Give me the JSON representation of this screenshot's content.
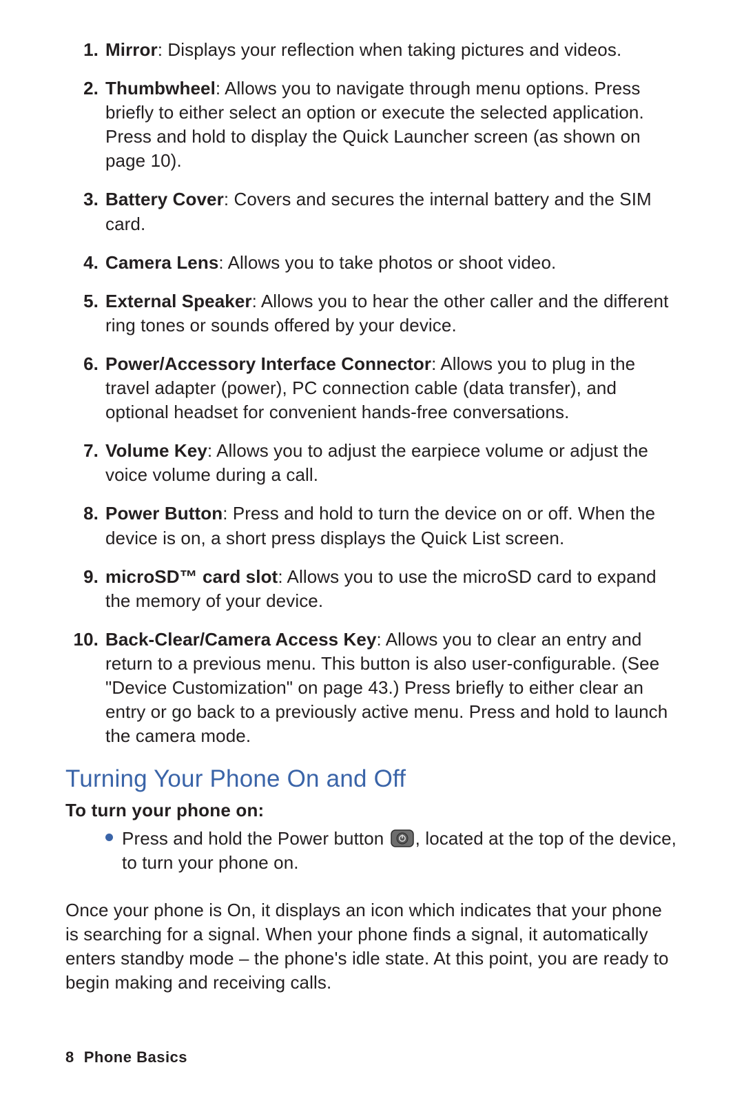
{
  "list": [
    {
      "term": "Mirror",
      "desc": ": Displays your reflection when taking pictures and videos."
    },
    {
      "term": "Thumbwheel",
      "desc": ": Allows you to navigate through menu options. Press briefly to either select an option or execute the selected application. Press and hold to display the Quick Launcher screen (as shown on page 10)."
    },
    {
      "term": "Battery Cover",
      "desc": ": Covers and secures the internal battery and the SIM card."
    },
    {
      "term": "Camera Lens",
      "desc": ": Allows you to take photos or shoot video."
    },
    {
      "term": "External Speaker",
      "desc": ": Allows you to hear the other caller and the different ring tones or sounds offered by your device."
    },
    {
      "term": "Power/Accessory Interface Connector",
      "desc": ": Allows you to plug in the travel adapter (power), PC connection cable (data transfer), and optional headset for convenient hands-free conversations."
    },
    {
      "term": "Volume Key",
      "desc": ": Allows you to adjust the earpiece volume or adjust the voice volume during a call."
    },
    {
      "term": "Power Button",
      "desc": ": Press and hold to turn the device on or off. When the device is on, a short press displays the Quick List screen."
    },
    {
      "term": "microSD™ card slot",
      "desc": ": Allows you to use the microSD card to expand the memory of your device."
    },
    {
      "term": "Back-Clear/Camera Access Key",
      "desc": ": Allows you to clear an entry and return to a previous menu. This button is also user-configurable. (See \"Device Customization\" on page 43.) Press briefly to either clear an entry or go back to a previously active menu. Press and hold to launch the camera mode."
    }
  ],
  "section_heading": "Turning Your Phone On and Off",
  "subheading": "To turn your phone on:",
  "bullet": {
    "before": "Press and hold the Power button ",
    "after": ", located at the top of the device, to turn your phone on."
  },
  "paragraph": "Once your phone is On, it displays an icon which indicates that your phone is searching for a signal. When your phone finds a signal, it automatically enters standby mode – the phone's idle state. At this point, you are ready to begin making and receiving calls.",
  "footer": {
    "page": "8",
    "title": "Phone Basics"
  }
}
